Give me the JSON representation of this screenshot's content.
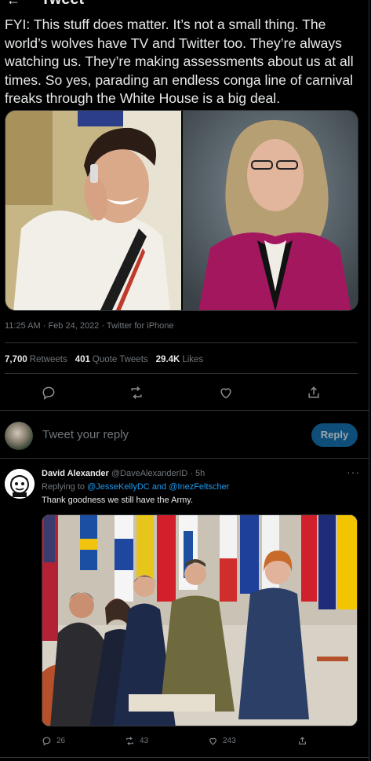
{
  "header": {
    "title": "Tweet",
    "back_icon": "arrow-left-icon"
  },
  "tweet": {
    "text": "FYI: This stuff does matter. It’s not a small thing. The world’s wolves have TV and Twitter too. They’re always watching us. They’re making assessments about us at all times. So yes, parading an endless conga line of carnival freaks through the White House is a big deal.",
    "time": "11:25 AM",
    "date": "Feb 24, 2022",
    "source": "Twitter for iPhone",
    "dot": "·",
    "stats": {
      "retweets_count": "7,700",
      "retweets_label": "Retweets",
      "quotes_count": "401",
      "quotes_label": "Quote Tweets",
      "likes_count": "29.4K",
      "likes_label": "Likes"
    }
  },
  "compose": {
    "placeholder": "Tweet your reply",
    "button_label": "Reply"
  },
  "reply": {
    "name": "David Alexander",
    "handle": "@DaveAlexanderID",
    "dot": "·",
    "age": "5h",
    "more": "···",
    "replying_prefix": "Replying to",
    "mention_1": "@JesseKellyDC",
    "and": "and",
    "mention_2": "@InezFeltscher",
    "text": "Thank goodness we still have the Army.",
    "counts": {
      "replies": "26",
      "retweets": "43",
      "likes": "243"
    }
  },
  "colors": {
    "background": "#000000",
    "text": "#e7e9ea",
    "muted": "#71767b",
    "border": "#2f3336",
    "link": "#1d9bf0",
    "reply_button": "#0f4e78"
  }
}
